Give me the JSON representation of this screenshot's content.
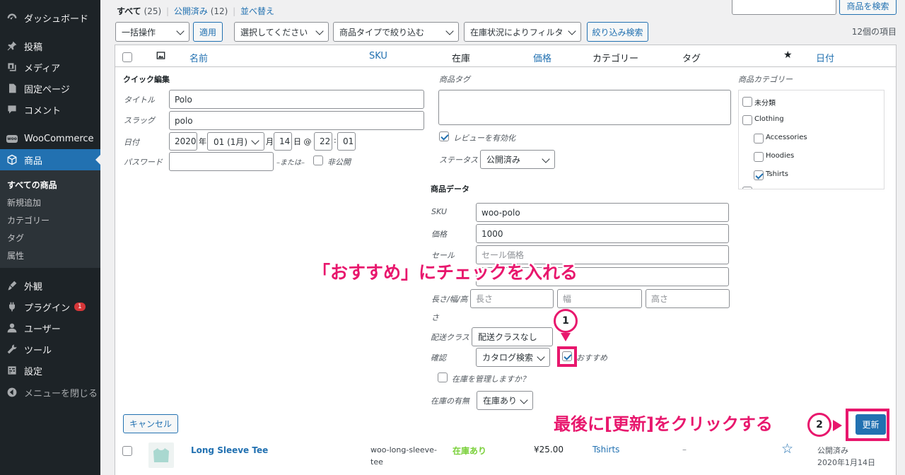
{
  "sidebar": {
    "items": [
      {
        "label": "ダッシュボード",
        "icon": "dashboard-icon"
      },
      {
        "label": "投稿",
        "icon": "pin-icon"
      },
      {
        "label": "メディア",
        "icon": "media-icon"
      },
      {
        "label": "固定ページ",
        "icon": "page-icon"
      },
      {
        "label": "コメント",
        "icon": "comment-icon"
      },
      {
        "label": "WooCommerce",
        "icon": "woo-icon",
        "icon_text": "woo"
      },
      {
        "label": "商品",
        "icon": "product-icon"
      },
      {
        "label": "外観",
        "icon": "brush-icon"
      },
      {
        "label": "プラグイン",
        "icon": "plugin-icon",
        "badge": "1"
      },
      {
        "label": "ユーザー",
        "icon": "user-icon"
      },
      {
        "label": "ツール",
        "icon": "wrench-icon"
      },
      {
        "label": "設定",
        "icon": "settings-icon"
      },
      {
        "label": "メニューを閉じる",
        "icon": "collapse-icon"
      }
    ],
    "submenu": [
      "すべての商品",
      "新規追加",
      "カテゴリー",
      "タグ",
      "属性"
    ]
  },
  "subsubsub": {
    "all": "すべて",
    "all_count": "(25)",
    "sep1": "|",
    "published": "公開済み",
    "published_count": "(12)",
    "sep2": "|",
    "sort": "並べ替え"
  },
  "search": {
    "value": "",
    "button": "商品を検索"
  },
  "filters": {
    "bulk": "一括操作",
    "apply": "適用",
    "category": "選択してください",
    "type": "商品タイプで絞り込む",
    "stock": "在庫状況によりフィルタ",
    "filter_button": "絞り込み検索",
    "count": "12個の項目"
  },
  "columns": {
    "name": "名前",
    "sku": "SKU",
    "stock": "在庫",
    "price": "価格",
    "categories": "カテゴリー",
    "tags": "タグ",
    "date": "日付"
  },
  "quick_edit": {
    "heading": "クイック編集",
    "title_label": "タイトル",
    "title_value": "Polo",
    "slug_label": "スラッグ",
    "slug_value": "polo",
    "date_label": "日付",
    "year": "2020",
    "year_suffix": "年",
    "month": "01 (1月)",
    "month_suffix": "月",
    "day": "14",
    "day_suffix": "日 @",
    "hour": "22",
    "colon": ":",
    "minute": "01",
    "password_label": "パスワード",
    "password_value": "",
    "or_text": "–または–",
    "private_label": "非公開",
    "tags_label": "商品タグ",
    "tags_value": "",
    "reviews_label": "レビューを有効化",
    "status_label": "ステータス",
    "status_value": "公開済み",
    "cat_heading": "商品カテゴリー",
    "categories": [
      {
        "label": "未分類",
        "checked": false,
        "indent": false
      },
      {
        "label": "Clothing",
        "checked": false,
        "indent": false
      },
      {
        "label": "Accessories",
        "checked": false,
        "indent": true
      },
      {
        "label": "Hoodies",
        "checked": false,
        "indent": true
      },
      {
        "label": "Tshirts",
        "checked": true,
        "indent": true
      }
    ],
    "product_data_heading": "商品データ",
    "sku_label": "SKU",
    "sku_value": "woo-polo",
    "price_label": "価格",
    "price_value": "1000",
    "sale_label": "セール",
    "sale_placeholder": "セール価格",
    "dimensions_label_1": "長さ/幅/高",
    "dimensions_label_2": "さ",
    "length_placeholder": "長さ",
    "width_placeholder": "幅",
    "height_placeholder": "高さ",
    "shipping_label": "配送クラス",
    "shipping_value": "配送クラスなし",
    "visibility_label": "確認",
    "visibility_value": "カタログ検索",
    "featured_label": "おすすめ",
    "manage_stock_label": "在庫を管理しますか？",
    "stock_status_label": "在庫の有無",
    "stock_status_value": "在庫あり",
    "cancel": "キャンセル",
    "update": "更新"
  },
  "row": {
    "name": "Long Sleeve Tee",
    "sku_line1": "woo-long-sleeve-",
    "sku_line2": "tee",
    "stock": "在庫あり",
    "price": "¥25.00",
    "category": "Tshirts",
    "tags": "–",
    "date_status": "公開済み",
    "date": "2020年1月14日"
  },
  "annotations": {
    "headline": "「おすすめ」にチェックを入れる",
    "step1": "1",
    "step2": "2",
    "footer": "最後に[更新]をクリックする"
  },
  "colors": {
    "accent": "#2271b1",
    "annotation": "#e8176d",
    "stock_in": "#7ad03a",
    "sidebar": "#1d2327"
  }
}
